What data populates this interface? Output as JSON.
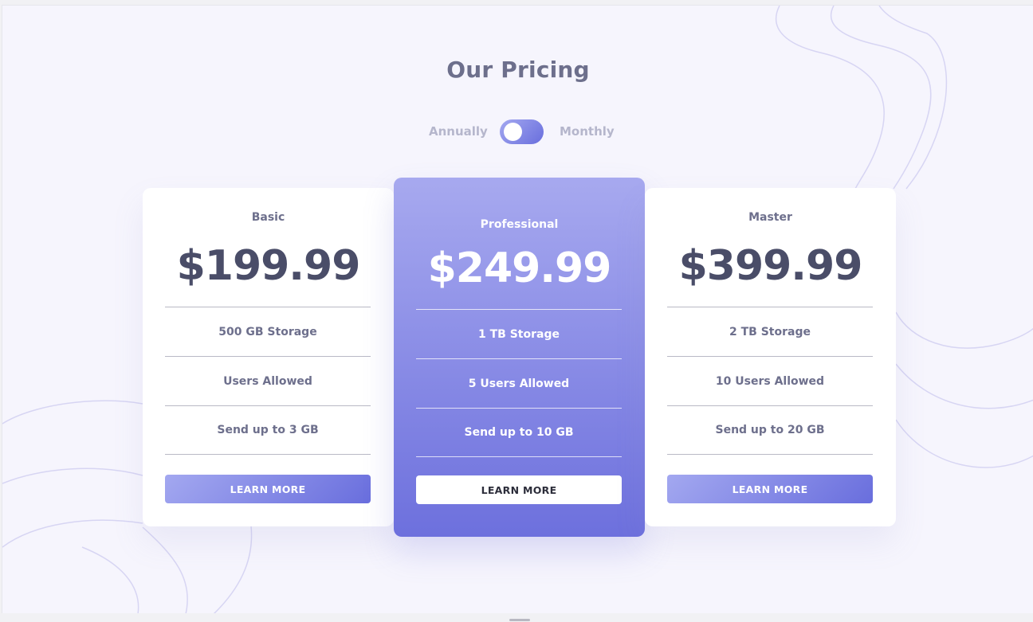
{
  "page": {
    "title": "Our Pricing"
  },
  "billing_toggle": {
    "left_label": "Annually",
    "right_label": "Monthly"
  },
  "plans": [
    {
      "name": "Basic",
      "price": "$199.99",
      "features": [
        "500 GB Storage",
        "Users Allowed",
        "Send up to 3 GB"
      ],
      "cta": "LEARN MORE"
    },
    {
      "name": "Professional",
      "price": "$249.99",
      "features": [
        "1 TB Storage",
        "5 Users Allowed",
        "Send up to 10 GB"
      ],
      "cta": "LEARN MORE"
    },
    {
      "name": "Master",
      "price": "$399.99",
      "features": [
        "2 TB Storage",
        "10 Users Allowed",
        "Send up to 20 GB"
      ],
      "cta": "LEARN MORE"
    }
  ],
  "colors": {
    "background": "#f6f5fd",
    "accent_start": "#a3a8f0",
    "accent_end": "#696edd",
    "text_dark": "#4a4d68",
    "text_muted": "#6d6f8c"
  }
}
